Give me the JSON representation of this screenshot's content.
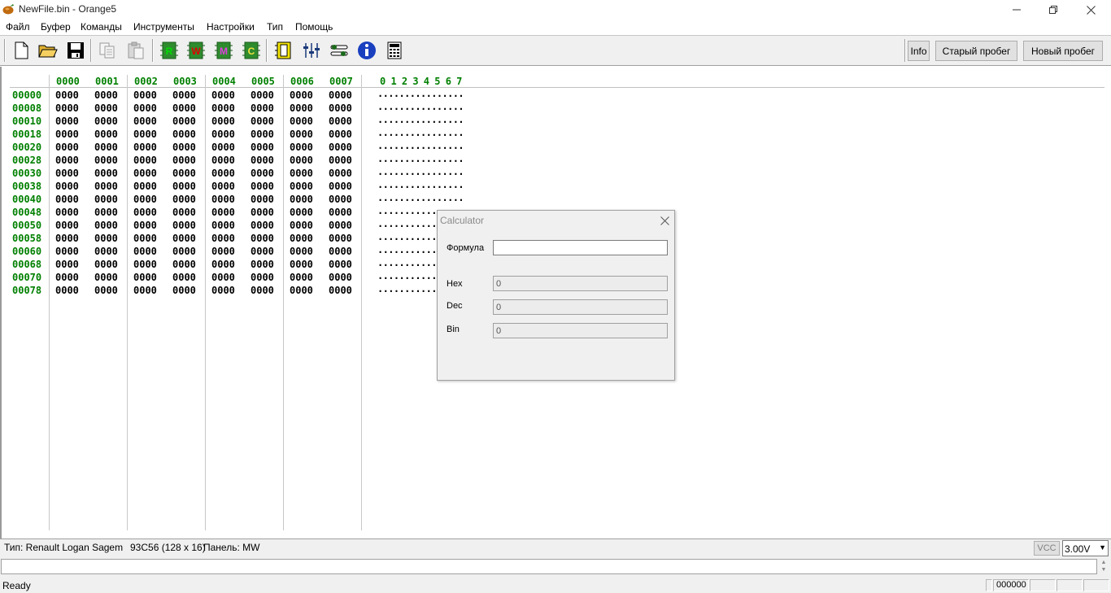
{
  "window": {
    "title": "NewFile.bin - Orange5",
    "minimize_icon": "minimize-icon",
    "maximize_icon": "restore-icon",
    "close_icon": "close-icon"
  },
  "menu": [
    "Файл",
    "Буфер",
    "Команды",
    "Инструменты",
    "Настройки",
    "Тип",
    "Помощь"
  ],
  "toolbar": {
    "icons": [
      "new-file-icon",
      "open-folder-icon",
      "save-icon",
      "copy-icon",
      "paste-icon",
      "read-chip-icon",
      "write-chip-icon",
      "m-chip-icon",
      "c-chip-icon",
      "chip-icon",
      "sliders-icon",
      "tools-icon",
      "info-icon",
      "calculator-icon"
    ],
    "chip_letters": {
      "read": "R",
      "write": "W",
      "m": "M",
      "c": "C"
    },
    "info_label": "Info",
    "old_mileage_label": "Старый пробег",
    "new_mileage_label": "Новый пробег"
  },
  "hex": {
    "column_headers": [
      "0000",
      "0001",
      "0002",
      "0003",
      "0004",
      "0005",
      "0006",
      "0007"
    ],
    "ascii_header": "0 1 2 3 4 5 6 7",
    "addresses": [
      "00000",
      "00008",
      "00010",
      "00018",
      "00020",
      "00028",
      "00030",
      "00038",
      "00040",
      "00048",
      "00050",
      "00058",
      "00060",
      "00068",
      "00070",
      "00078"
    ],
    "cell_value": "0000",
    "ascii_row": "................"
  },
  "typebar": {
    "type_text": "Тип: Renault Logan Sagem",
    "chip_text": "93C56 (128 x 16)",
    "panel_text": "Панель: MW",
    "vcc_label": "VCC",
    "voltage_value": "3.00V"
  },
  "status": {
    "ready": "Ready",
    "position": "000000"
  },
  "calculator": {
    "title": "Calculator",
    "formula_label": "Формула",
    "formula_value": "",
    "hex_label": "Hex",
    "hex_value": "0",
    "dec_label": "Dec",
    "dec_value": "0",
    "bin_label": "Bin",
    "bin_value": "0"
  },
  "colors": {
    "address_green": "#008000",
    "toolbar_bg": "#f0f0f0",
    "info_blue": "#1a3fbf"
  }
}
